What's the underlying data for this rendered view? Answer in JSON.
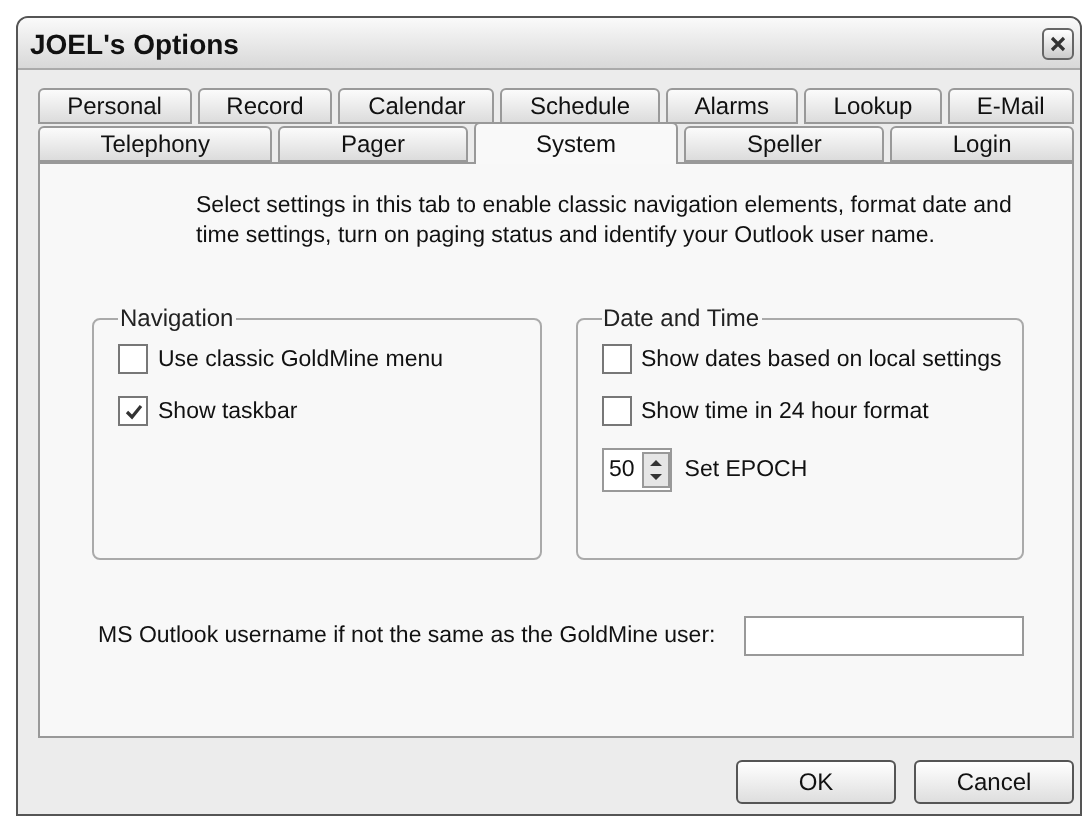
{
  "window": {
    "title": "JOEL's Options"
  },
  "tabs": [
    [
      {
        "label": "Personal",
        "selected": false
      },
      {
        "label": "Record",
        "selected": false
      },
      {
        "label": "Calendar",
        "selected": false
      },
      {
        "label": "Schedule",
        "selected": false
      },
      {
        "label": "Alarms",
        "selected": false
      },
      {
        "label": "Lookup",
        "selected": false
      },
      {
        "label": "E-Mail",
        "selected": false
      }
    ],
    [
      {
        "label": "Telephony",
        "selected": false
      },
      {
        "label": "Pager",
        "selected": false
      },
      {
        "label": "System",
        "selected": true
      },
      {
        "label": "Speller",
        "selected": false
      },
      {
        "label": "Login",
        "selected": false
      }
    ]
  ],
  "description": "Select settings in this tab to enable classic navigation elements, format date and time settings, turn on paging status and identify your Outlook user name.",
  "groups": [
    {
      "title": "Navigation",
      "items": [
        {
          "kind": "checkbox",
          "label": "Use classic GoldMine menu",
          "checked": false
        },
        {
          "kind": "checkbox",
          "label": "Show taskbar",
          "checked": true
        }
      ]
    },
    {
      "title": "Date and Time",
      "items": [
        {
          "kind": "checkbox",
          "label": "Show dates based on local settings",
          "checked": false
        },
        {
          "kind": "checkbox",
          "label": "Show time in 24 hour format",
          "checked": false
        },
        {
          "kind": "spinner",
          "value": "50",
          "label": "Set EPOCH"
        }
      ]
    }
  ],
  "outlook": {
    "label": "MS Outlook username if not the same as the GoldMine user:"
  },
  "buttons": [
    "OK",
    "Cancel"
  ]
}
